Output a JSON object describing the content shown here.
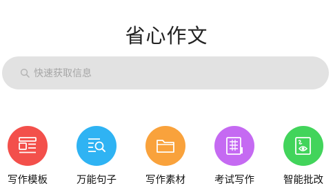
{
  "app": {
    "title": "省心作文"
  },
  "search": {
    "placeholder": "快速获取信息",
    "icon": "search-icon"
  },
  "features": [
    {
      "label": "写作模板",
      "color": "#f3504b",
      "icon": "template-icon"
    },
    {
      "label": "万能句子",
      "color": "#2fb3f3",
      "icon": "sentence-search-icon"
    },
    {
      "label": "写作素材",
      "color": "#f9a23c",
      "icon": "folder-icon"
    },
    {
      "label": "考试写作",
      "color": "#c56af2",
      "icon": "exam-paper-icon"
    },
    {
      "label": "智能批改",
      "color": "#42d45b",
      "icon": "eye-review-icon"
    }
  ]
}
